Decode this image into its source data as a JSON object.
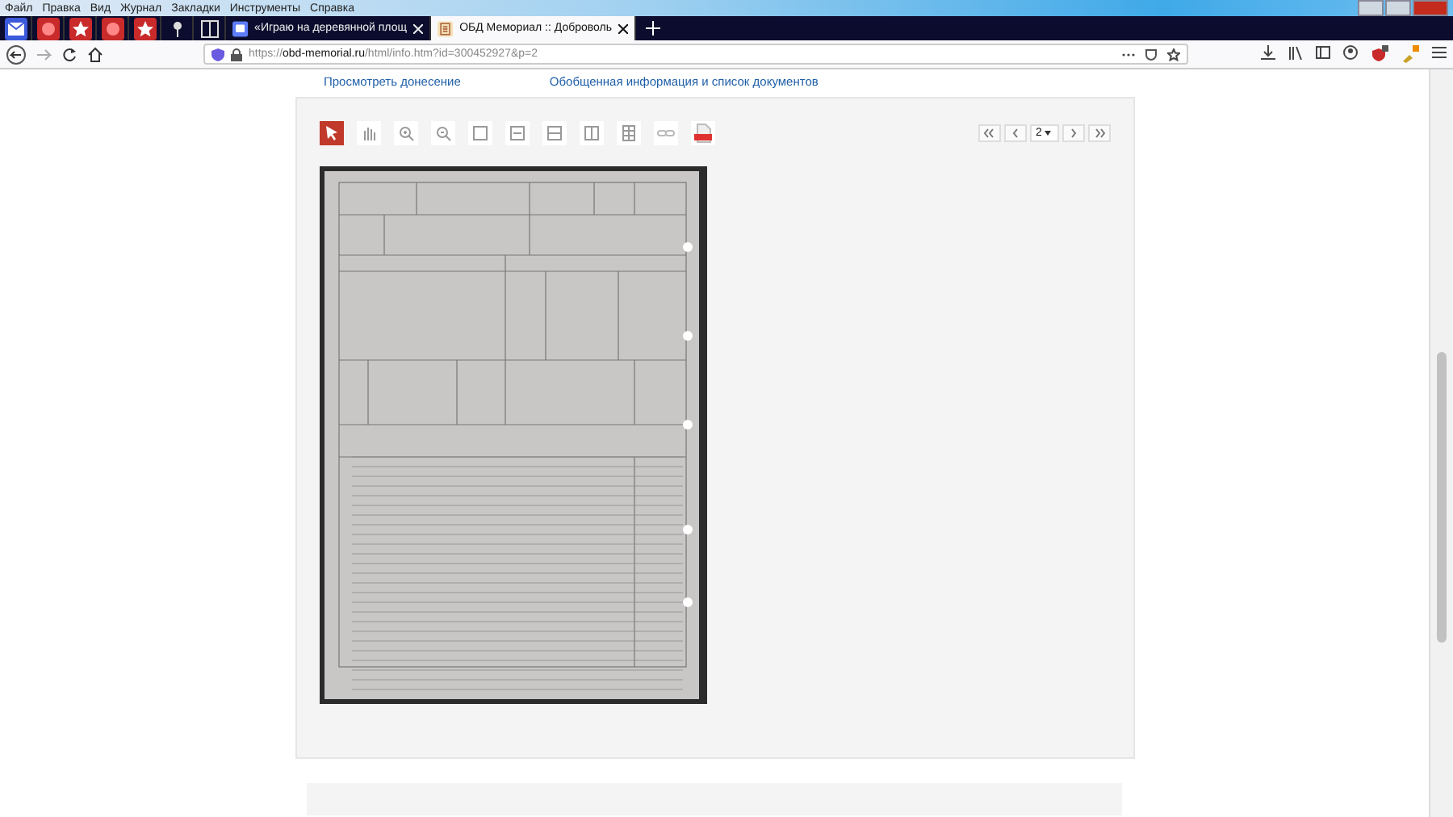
{
  "menu": [
    "Файл",
    "Правка",
    "Вид",
    "Журнал",
    "Закладки",
    "Инструменты",
    "Справка"
  ],
  "tabs": [
    {
      "kind": "pinned",
      "selected": false
    },
    {
      "kind": "pinned",
      "selected": false
    },
    {
      "kind": "pinned",
      "selected": false
    },
    {
      "kind": "pinned",
      "selected": false
    },
    {
      "kind": "pinned",
      "selected": false
    },
    {
      "kind": "pinned",
      "selected": false
    },
    {
      "kind": "pinned",
      "selected": false
    },
    {
      "kind": "full",
      "title": "«Играю на деревянной площ",
      "selected": false
    },
    {
      "kind": "full",
      "title": "ОБД Мемориал :: Доброволь",
      "selected": true
    }
  ],
  "address_bar": {
    "url_prefix": "https://",
    "url_domain": "obd-memorial.ru",
    "url_path": "/html/info.htm?id=300452927&p=2"
  },
  "page_links": [
    "Просмотреть донесение",
    "Обобщенная информация и список документов"
  ],
  "viewer_tools": [
    {
      "selected": true
    },
    {
      "selected": false
    },
    {
      "selected": false
    },
    {
      "selected": false
    },
    {
      "selected": false
    },
    {
      "selected": false
    },
    {
      "selected": false
    },
    {
      "selected": false
    },
    {
      "selected": false
    },
    {
      "selected": false
    },
    {
      "selected": false
    }
  ],
  "pager": {
    "page": "2"
  }
}
